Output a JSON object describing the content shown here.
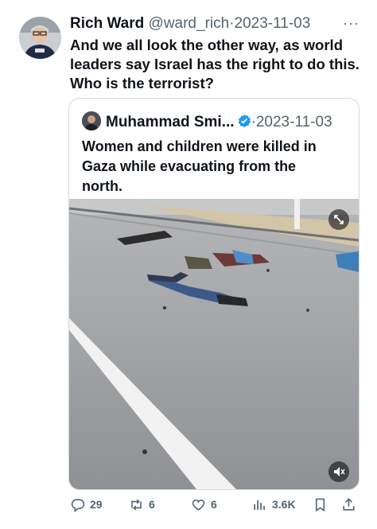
{
  "author": {
    "name": "Rich Ward",
    "handle": "@ward_rich",
    "separator": "·",
    "date": "2023-11-03",
    "more": "···"
  },
  "tweet_text": "And we all look the other way, as world leaders say Israel has the right to do this. Who is the terrorist?",
  "quoted": {
    "name": "Muhammad Smi...",
    "separator": "·",
    "date": "2023-11-03",
    "text": "Women and children were killed in Gaza while evacuating from the north.",
    "verified_color": "#1d9bf0"
  },
  "media": {
    "expand_icon": "expand-icon",
    "mute_icon": "mute-icon"
  },
  "actions": {
    "replies": "29",
    "retweets": "6",
    "likes": "6",
    "views": "3.6K"
  },
  "colors": {
    "text": "#0f1419",
    "secondary": "#536471",
    "border": "#cfd9de"
  }
}
